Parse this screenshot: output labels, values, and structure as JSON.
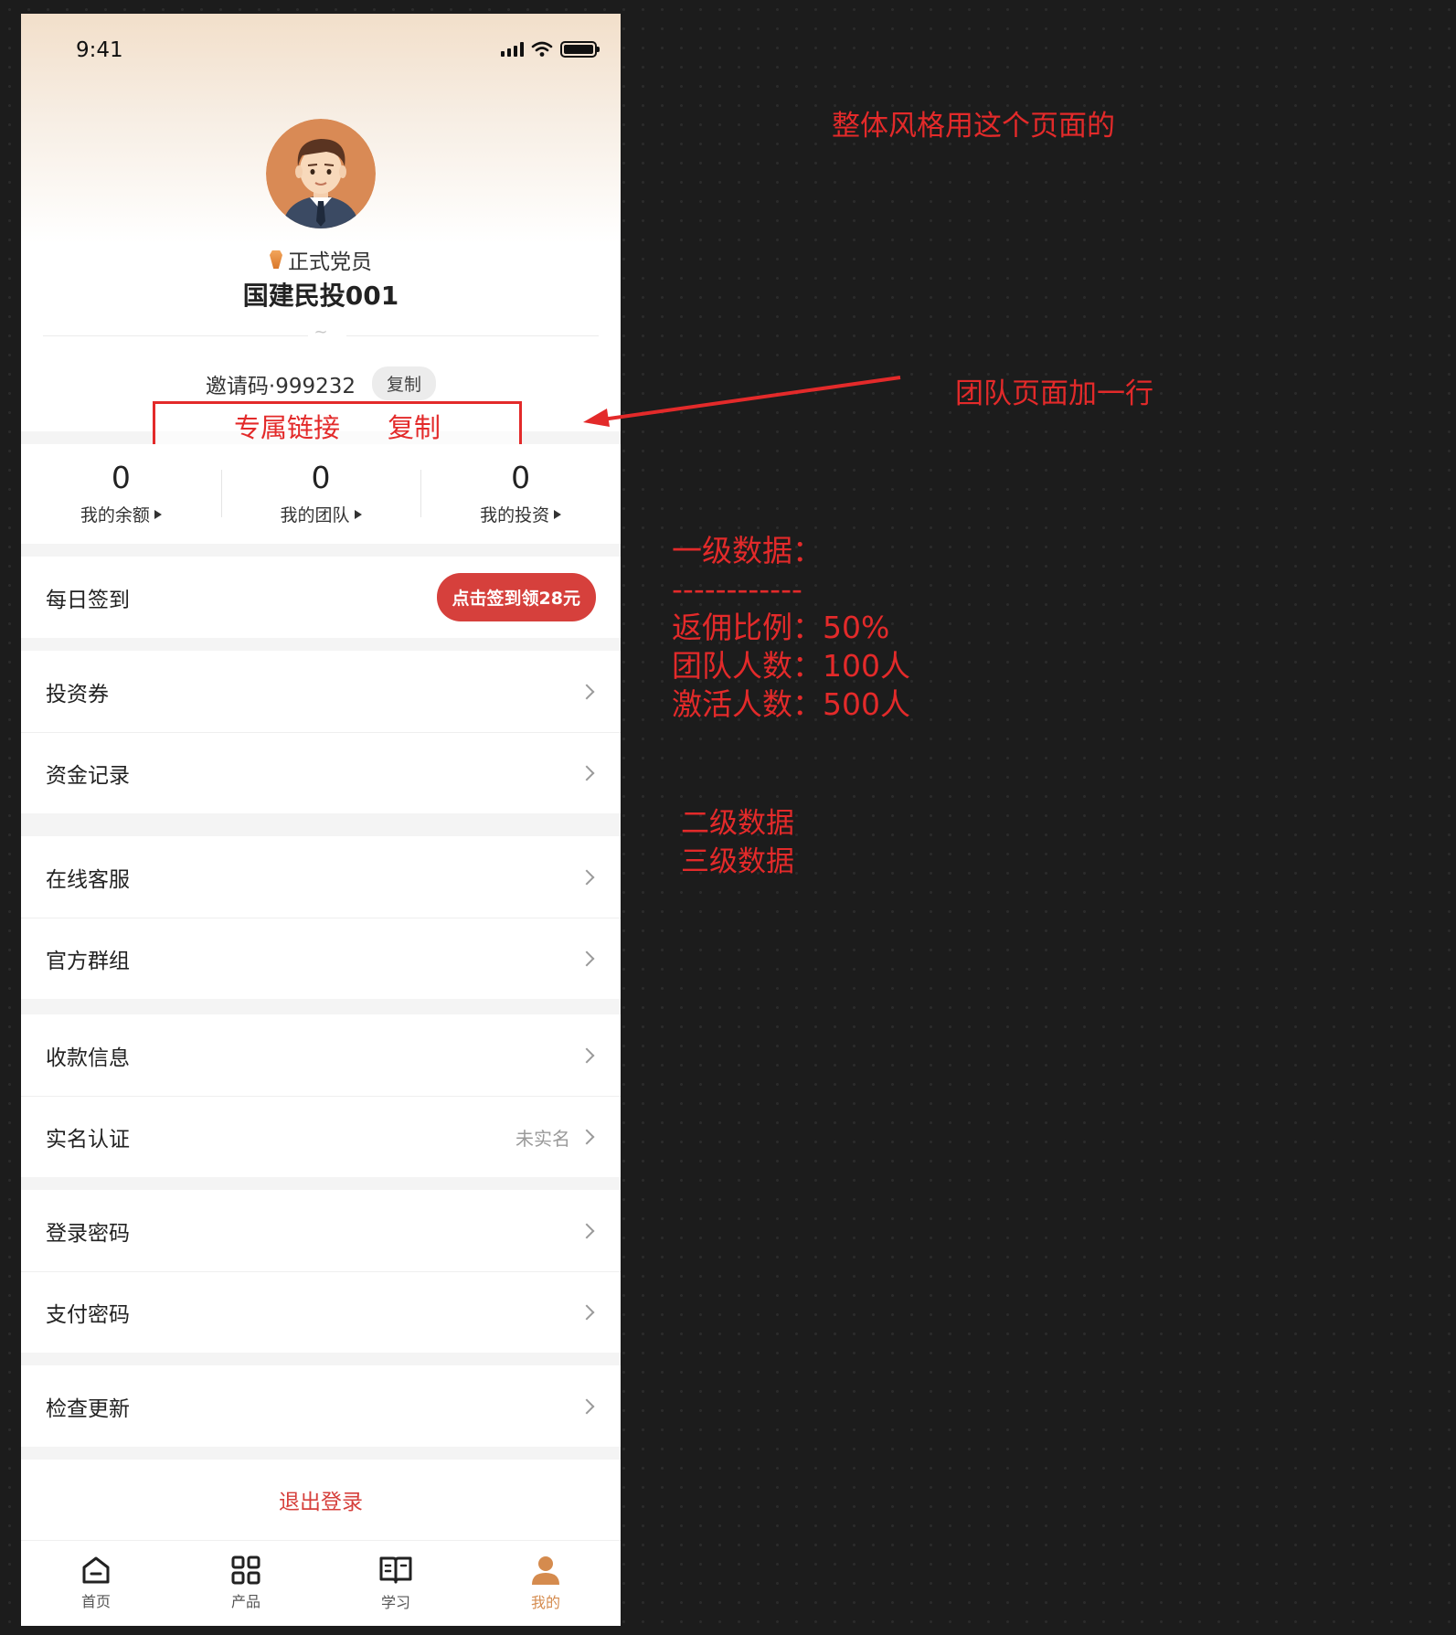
{
  "status_bar": {
    "time": "9:41"
  },
  "profile": {
    "member_level": "正式党员",
    "username": "国建民投001",
    "tilde": "~",
    "invite_label": "邀请码·999232",
    "copy_label": "复制",
    "exclusive_link_label": "专属链接",
    "exclusive_copy_label": "复制"
  },
  "stats": [
    {
      "value": "0",
      "label": "我的余额"
    },
    {
      "value": "0",
      "label": "我的团队"
    },
    {
      "value": "0",
      "label": "我的投资"
    }
  ],
  "checkin": {
    "label": "每日签到",
    "button": "点击签到领28元"
  },
  "menu": {
    "coupons": "投资券",
    "fund_records": "资金记录",
    "online_service": "在线客服",
    "official_group": "官方群组",
    "payment_info": "收款信息",
    "real_name": "实名认证",
    "real_name_status": "未实名",
    "login_password": "登录密码",
    "pay_password": "支付密码",
    "check_update": "检查更新"
  },
  "logout_label": "退出登录",
  "tabbar": [
    {
      "icon": "home-icon",
      "label": "首页",
      "active": false
    },
    {
      "icon": "grid-icon",
      "label": "产品",
      "active": false
    },
    {
      "icon": "book-icon",
      "label": "学习",
      "active": false
    },
    {
      "icon": "user-icon",
      "label": "我的",
      "active": true
    }
  ],
  "annotations": {
    "style_note": "整体风格用这个页面的",
    "team_note": "团队页面加一行",
    "level1_title": "一级数据：",
    "level1_separator": "------------",
    "level1_rebate": "返佣比例：50%",
    "level1_team_count": "团队人数：100人",
    "level1_activated": "激活人数：500人",
    "level2": "二级数据",
    "level3": "三级数据"
  },
  "colors": {
    "accent_red": "#d6403c",
    "annotation_red": "#e32a2a",
    "active_tab": "#d58b4e",
    "canvas_bg": "#1c1c1c"
  }
}
